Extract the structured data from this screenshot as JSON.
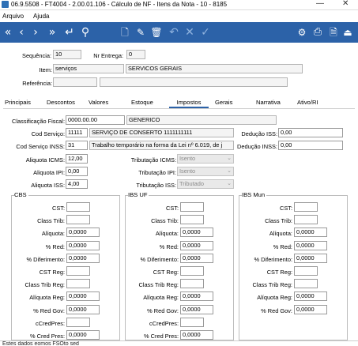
{
  "window": {
    "title": "06.9.5508 - FT4004 - 2.00.01.106 - Cálculo de NF - Itens da Nota - 10 - 8185",
    "minimize": "—",
    "close": "✕"
  },
  "menu": {
    "arquivo": "Arquivo",
    "ajuda": "Ajuda"
  },
  "toolbar": {
    "first": "«",
    "prev": "‹",
    "next": "›",
    "last": "»",
    "goto": "↵",
    "search": "⚲",
    "new": "🗋",
    "edit": "✎",
    "delete": "🗑",
    "undo": "↶",
    "cancel": "✕",
    "confirm": "✓",
    "tree": "⚙",
    "print": "⎙",
    "docs": "🗎",
    "exit": "⏏"
  },
  "header": {
    "sequencia_label": "Sequência:",
    "sequencia_value": "10",
    "nr_entrega_label": "Nr Entrega:",
    "nr_entrega_value": "0",
    "item_label": "Item:",
    "item_code": "serviços",
    "item_desc": "SERVICOS GERAIS",
    "referencia_label": "Referência:",
    "referencia_code": "",
    "referencia_desc": ""
  },
  "tabs": [
    "Principais",
    "Descontos",
    "Valores",
    "Estoque",
    "Impostos",
    "Gerais",
    "Narrativa",
    "Ativo/RI"
  ],
  "impostos": {
    "class_fiscal_label": "Classificação Fiscal:",
    "class_fiscal_value": "0000.00.00",
    "class_fiscal_desc": "GENERICO",
    "cod_servico_label": "Cod Serviço:",
    "cod_servico_code": "11111",
    "cod_servico_desc": "SERVIÇO DE CONSERTO 1111111111",
    "deducao_iss_label": "Dedução ISS:",
    "deducao_iss_value": "0,00",
    "cod_servico_inss_label": "Cod Serviço INSS:",
    "cod_servico_inss_code": "31",
    "cod_servico_inss_desc": "Trabalho temporário na forma da Lei nº 6.019, de j",
    "deducao_inss_label": "Dedução INSS:",
    "deducao_inss_value": "0,00",
    "aliq_icms_label": "Aliquota ICMS:",
    "aliq_icms_value": "12,00",
    "trib_icms_label": "Tributação ICMS:",
    "trib_icms_value": "Isento",
    "aliq_ipi_label": "Aliquota IPI:",
    "aliq_ipi_value": "0,00",
    "trib_ipi_label": "Tributação IPI:",
    "trib_ipi_value": "Isento",
    "aliq_iss_label": "Aliquota ISS:",
    "aliq_iss_value": "4,00",
    "trib_iss_label": "Tributação ISS:",
    "trib_iss_value": "Tributado"
  },
  "groups": [
    {
      "title": "CBS",
      "rows": [
        {
          "label": "CST:",
          "value": "",
          "short": true
        },
        {
          "label": "Class Trib:",
          "value": "",
          "short": true
        },
        {
          "label": "Alíquota:",
          "value": "0,0000"
        },
        {
          "label": "% Red:",
          "value": "0,0000"
        },
        {
          "label": "% Diferimento:",
          "value": "0,0000"
        },
        {
          "label": "CST Reg:",
          "value": "",
          "short": true
        },
        {
          "label": "Class Trib Reg:",
          "value": "",
          "short": true
        },
        {
          "label": "Alíquota Reg:",
          "value": "0,0000"
        },
        {
          "label": "% Red Gov:",
          "value": "0,0000"
        },
        {
          "label": "cCredPres:",
          "value": "",
          "short": true
        },
        {
          "label": "% Cred Pres:",
          "value": "0,0000"
        }
      ]
    },
    {
      "title": "IBS UF",
      "rows": [
        {
          "label": "CST:",
          "value": "",
          "short": true
        },
        {
          "label": "Class Trib:",
          "value": "",
          "short": true
        },
        {
          "label": "Alíquota:",
          "value": "0,0000"
        },
        {
          "label": "% Red:",
          "value": "0,0000"
        },
        {
          "label": "% Diferimento:",
          "value": "0,0000"
        },
        {
          "label": "CST Reg:",
          "value": "",
          "short": true
        },
        {
          "label": "Class Trib Reg:",
          "value": "",
          "short": true
        },
        {
          "label": "Alíquota Reg:",
          "value": "0,0000"
        },
        {
          "label": "% Red Gov:",
          "value": "0,0000"
        },
        {
          "label": "cCredPres:",
          "value": "",
          "short": true
        },
        {
          "label": "% Cred Pres:",
          "value": "0,0000"
        }
      ]
    },
    {
      "title": "IBS Mun",
      "rows": [
        {
          "label": "CST:",
          "value": "",
          "short": true
        },
        {
          "label": "Class Trib:",
          "value": "",
          "short": true
        },
        {
          "label": "Alíquota:",
          "value": "0,0000"
        },
        {
          "label": "% Red:",
          "value": "0,0000"
        },
        {
          "label": "% Diferimento:",
          "value": "0,0000"
        },
        {
          "label": "CST Reg:",
          "value": "",
          "short": true
        },
        {
          "label": "Class Trib Reg:",
          "value": "",
          "short": true
        },
        {
          "label": "Alíquota Reg:",
          "value": "0,0000"
        },
        {
          "label": "% Red Gov:",
          "value": "0,0000"
        }
      ]
    }
  ],
  "status": "Estes dados eomos FSOto sed"
}
